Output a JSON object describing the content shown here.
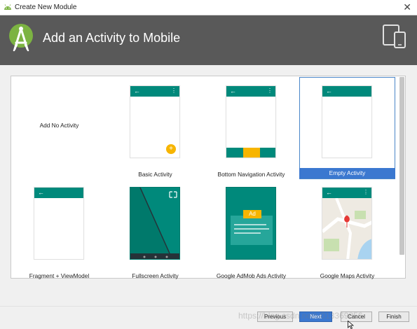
{
  "window": {
    "title": "Create New Module",
    "close_glyph": "✕"
  },
  "header": {
    "title": "Add an Activity to Mobile",
    "logo_icon": "android-studio-icon",
    "device_icon": "phone-tablet-icon"
  },
  "colors": {
    "appbar": "#00897b",
    "fab": "#f7b500",
    "selection": "#3b78d0",
    "header_bg": "#595959"
  },
  "activities": [
    {
      "label": "Add No Activity",
      "selected": false
    },
    {
      "label": "Basic Activity",
      "selected": false
    },
    {
      "label": "Bottom Navigation Activity",
      "selected": false
    },
    {
      "label": "Empty Activity",
      "selected": true
    },
    {
      "label": "Fragment + ViewModel",
      "selected": false
    },
    {
      "label": "Fullscreen Activity",
      "selected": false
    },
    {
      "label": "Google AdMob Ads Activity",
      "selected": false,
      "ad_badge": "Ad"
    },
    {
      "label": "Google Maps Activity",
      "selected": false
    }
  ],
  "footer": {
    "previous_label": "Previous",
    "next_label": "Next",
    "cancel_label": "Cancel",
    "finish_label": "Finish",
    "watermark": "https://blog.csdn.net/u013369856"
  }
}
